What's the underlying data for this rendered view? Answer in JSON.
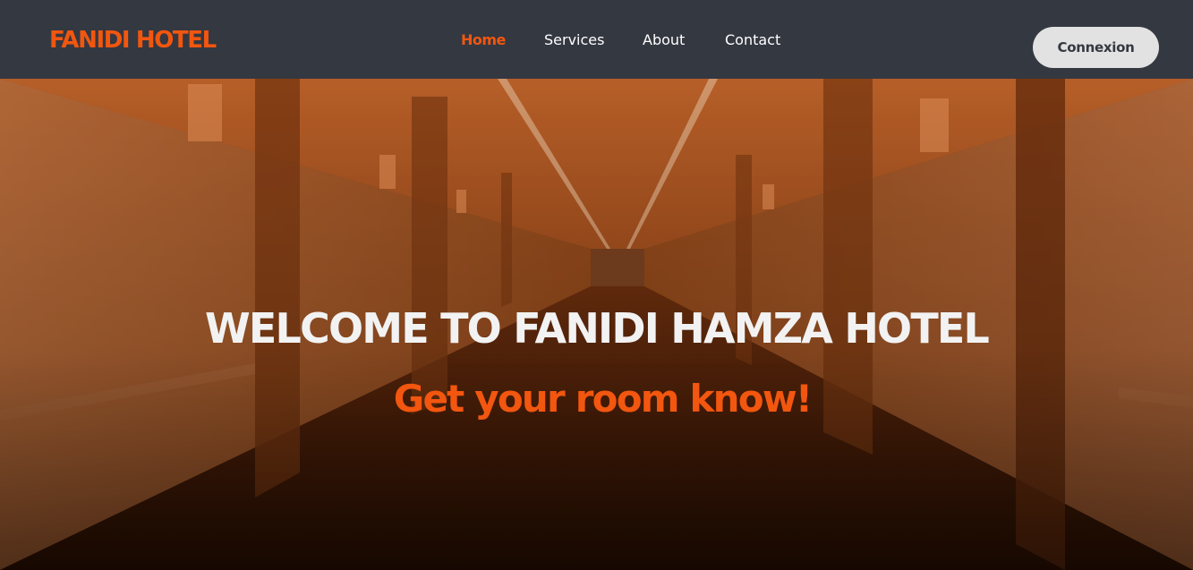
{
  "brand": {
    "logo": "FANIDI HOTEL",
    "accent_color": "#f2560f"
  },
  "nav": {
    "links": [
      {
        "label": "Home",
        "active": true
      },
      {
        "label": "Services",
        "active": false
      },
      {
        "label": "About",
        "active": false
      },
      {
        "label": "Contact",
        "active": false
      }
    ],
    "login_label": "Connexion"
  },
  "hero": {
    "title": "WELCOME TO FANIDI HAMZA HOTEL",
    "subtitle": "Get your room know!",
    "background": "hotel-corridor-image"
  }
}
